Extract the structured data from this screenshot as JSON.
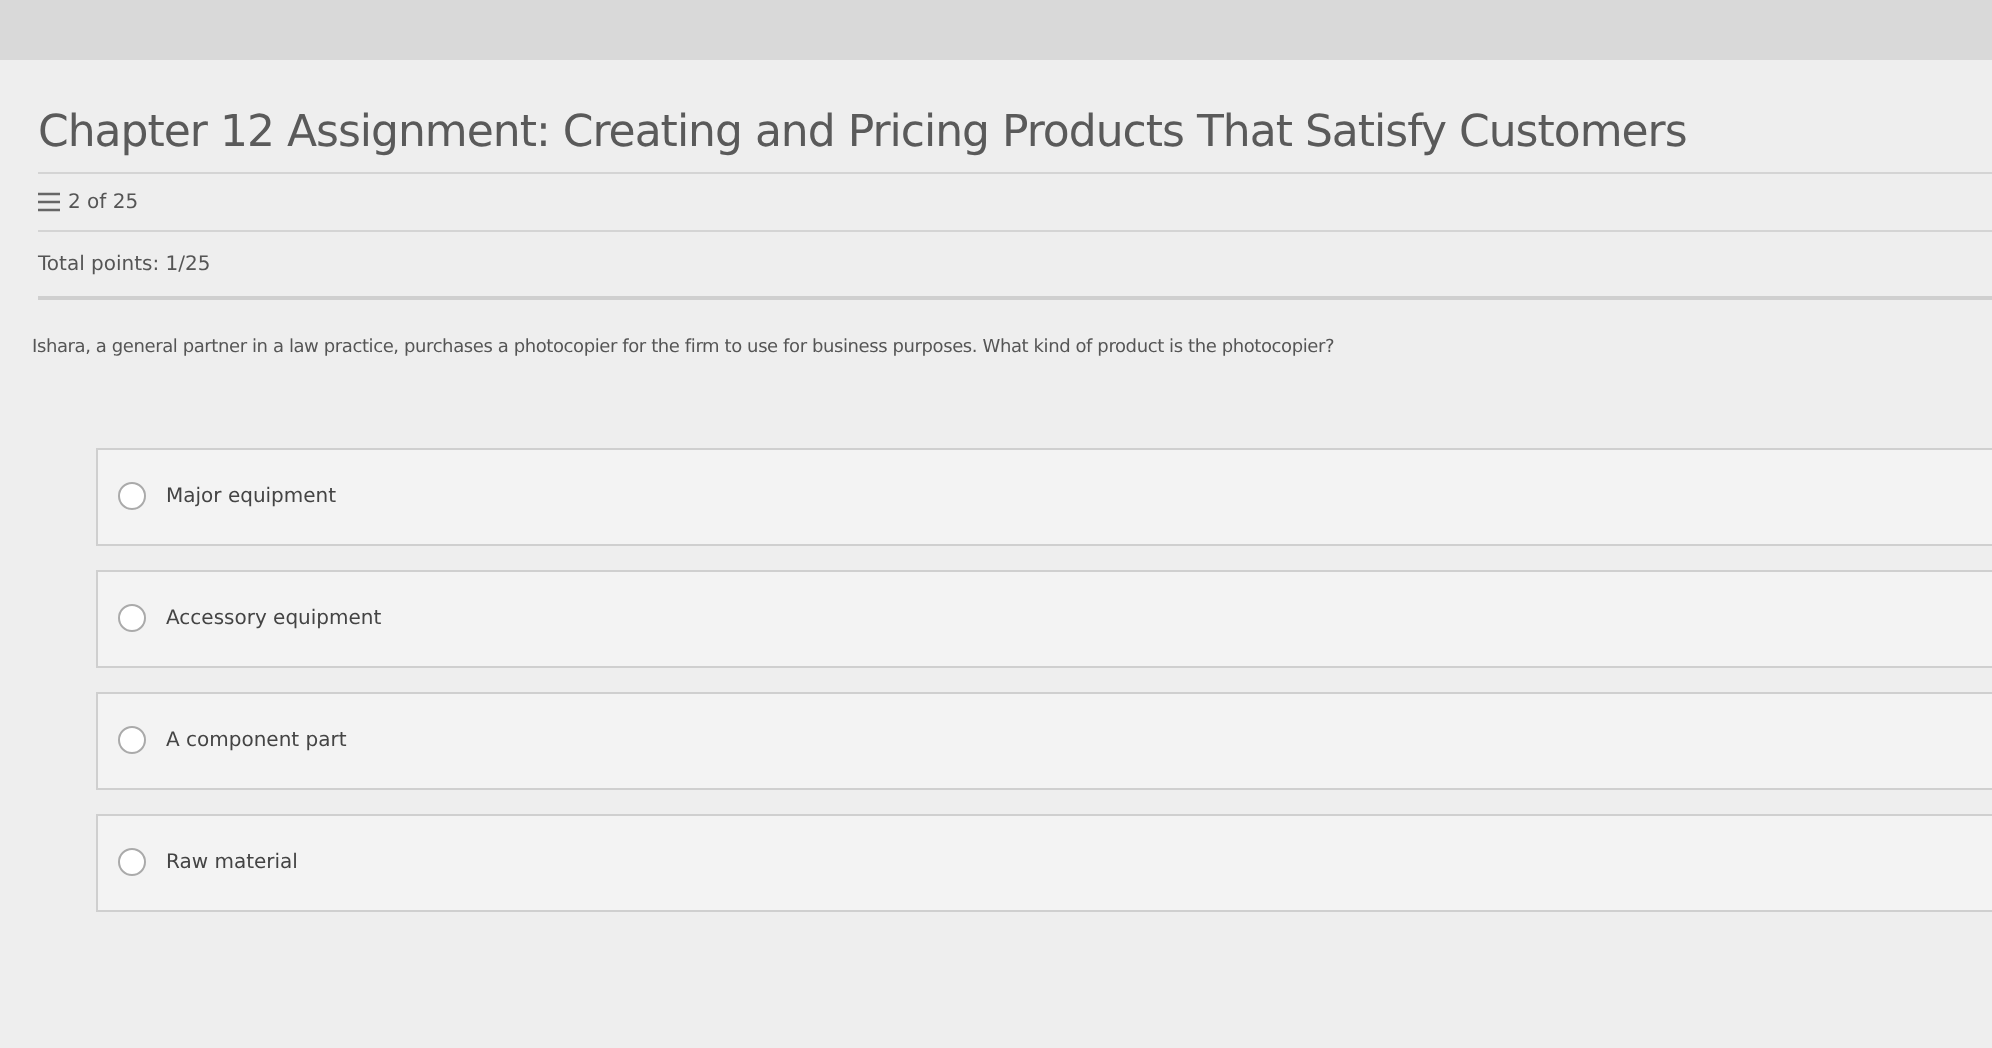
{
  "title": "Chapter 12 Assignment: Creating and Pricing Products That Satisfy Customers",
  "progress": "2 of 25",
  "total_points": "Total points: 1/25",
  "question": "Ishara, a general partner in a law practice, purchases a photocopier for the firm to use for business purposes. What kind of product is the photocopier?",
  "options": [
    {
      "label": "Major equipment",
      "selected": false
    },
    {
      "label": "Accessory equipment",
      "selected": false
    },
    {
      "label": "A component part",
      "selected": false
    },
    {
      "label": "Raw material",
      "selected": false
    }
  ]
}
